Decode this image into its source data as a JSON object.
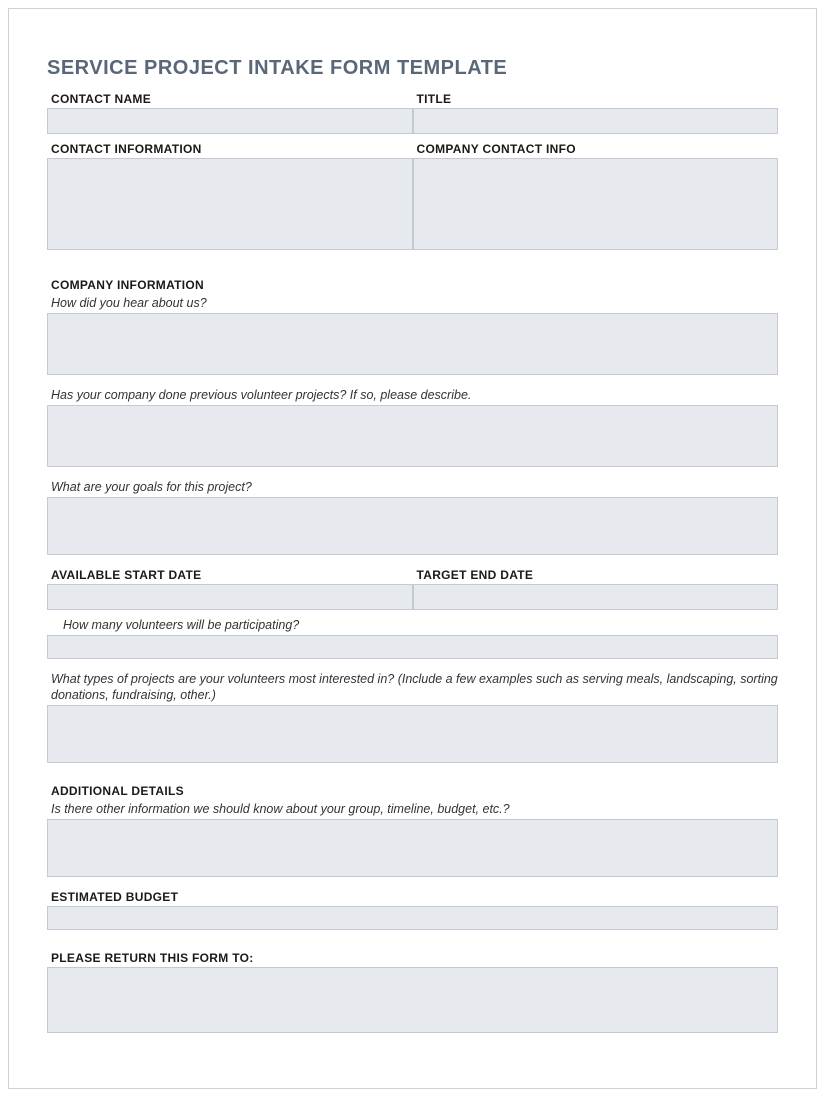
{
  "title": "SERVICE PROJECT INTAKE FORM TEMPLATE",
  "contact": {
    "name_label": "CONTACT NAME",
    "title_label": "TITLE",
    "info_label": "CONTACT INFORMATION",
    "company_contact_label": "COMPANY CONTACT INFO"
  },
  "company": {
    "section_label": "COMPANY INFORMATION",
    "hear_about": "How did you hear about us?",
    "previous_projects": "Has your company done previous volunteer projects? If so, please describe.",
    "goals": "What are your goals for this project?",
    "start_date_label": "AVAILABLE START DATE",
    "end_date_label": "TARGET END DATE",
    "volunteers_count": "How many volunteers will be participating?",
    "project_types": "What types of projects are your volunteers most interested in? (Include a few examples such as serving meals, landscaping, sorting donations, fundraising, other.)"
  },
  "additional": {
    "section_label": "ADDITIONAL DETAILS",
    "other_info": "Is there other information we should know about your group, timeline, budget, etc.?",
    "budget_label": "ESTIMATED BUDGET",
    "return_label": "PLEASE RETURN THIS FORM TO:"
  }
}
